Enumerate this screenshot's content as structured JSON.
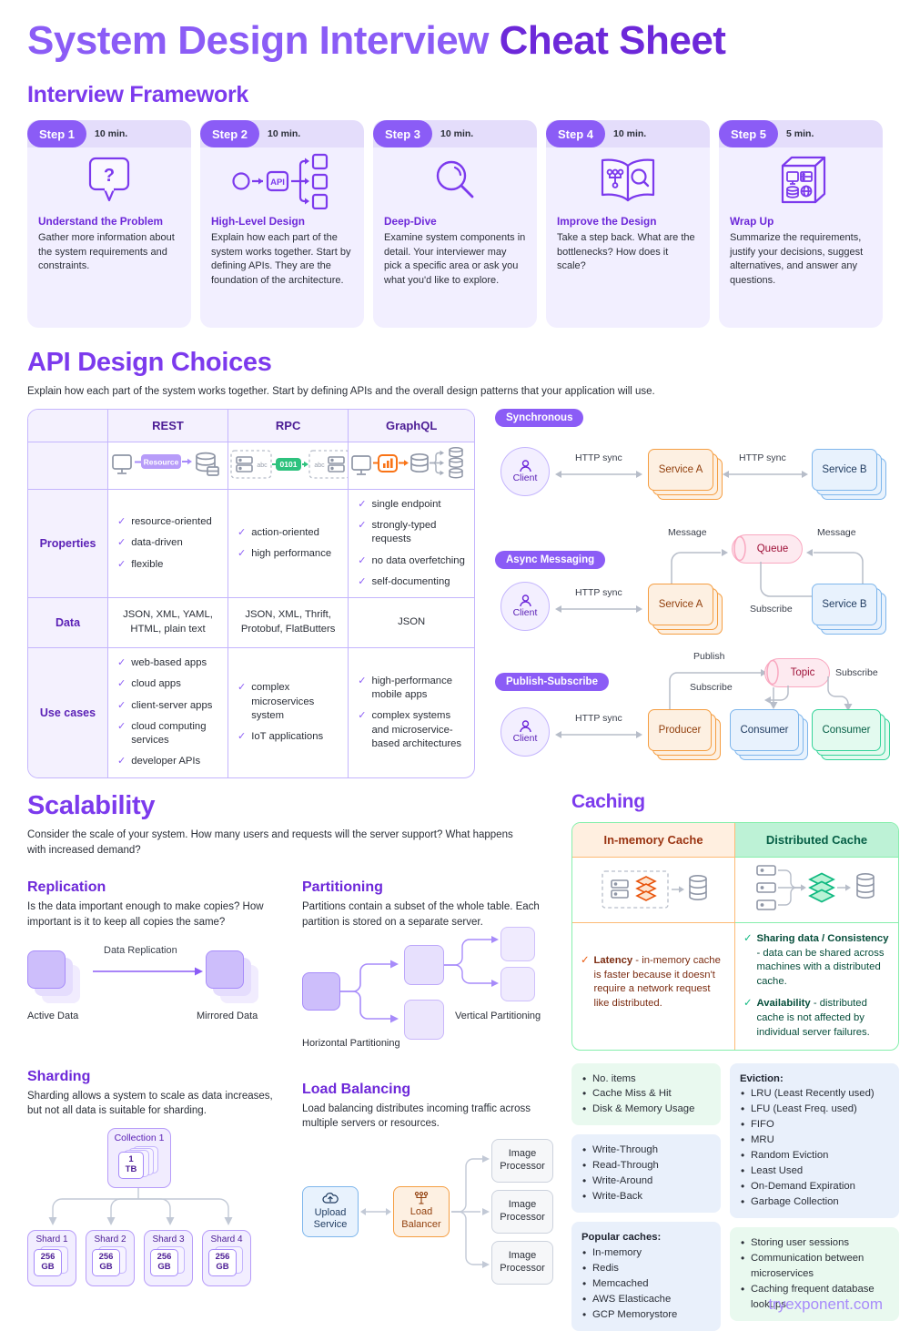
{
  "title": {
    "light": "System Design Interview ",
    "dark": "Cheat Sheet"
  },
  "brand": "tryexponent.com",
  "framework": {
    "heading": "Interview Framework",
    "steps": [
      {
        "step": "Step 1",
        "time": "10 min.",
        "name": "Understand the Problem",
        "desc": "Gather more information about the system requirements and constraints.",
        "icon": "question-bubble-icon"
      },
      {
        "step": "Step 2",
        "time": "10 min.",
        "name": "High-Level Design",
        "desc": "Explain how each part of the system works together. Start by defining APIs. They are the foundation of the architecture.",
        "icon": "api-flow-icon"
      },
      {
        "step": "Step 3",
        "time": "10 min.",
        "name": "Deep-Dive",
        "desc": "Examine system components in detail. Your interviewer may pick a specific area or ask you what you'd like to explore.",
        "icon": "magnifier-icon"
      },
      {
        "step": "Step 4",
        "time": "10 min.",
        "name": "Improve the Design",
        "desc": "Take a step back. What are the bottlenecks? How does it scale?",
        "icon": "open-book-icon"
      },
      {
        "step": "Step 5",
        "time": "5 min.",
        "name": "Wrap Up",
        "desc": "Summarize the requirements, justify your decisions, suggest alternatives, and answer any questions.",
        "icon": "package-box-icon"
      }
    ]
  },
  "api": {
    "heading": "API Design Choices",
    "intro": "Explain how each part of the system works together. Start by defining APIs and the overall design patterns that your application will use.",
    "columns": [
      "REST",
      "RPC",
      "GraphQL"
    ],
    "rows": {
      "properties_label": "Properties",
      "data_label": "Data",
      "usecases_label": "Use cases",
      "properties": [
        [
          "resource-oriented",
          "data-driven",
          "flexible"
        ],
        [
          "action-oriented",
          "high performance"
        ],
        [
          "single endpoint",
          "strongly-typed requests",
          "no data overfetching",
          "self-documenting"
        ]
      ],
      "data": [
        "JSON, XML, YAML, HTML, plain text",
        "JSON, XML, Thrift, Protobuf, FlatButters",
        "JSON"
      ],
      "usecases": [
        [
          "web-based apps",
          "cloud apps",
          "client-server apps",
          "cloud computing services",
          "developer APIs"
        ],
        [
          "complex microservices system",
          "IoT applications"
        ],
        [
          "high-performance mobile apps",
          "complex systems and microservice-based architectures"
        ]
      ]
    },
    "rest_badge": "Resource",
    "rpc_badge": "0101",
    "rpc_abc": "abc"
  },
  "comms": {
    "sync": {
      "tag": "Synchronous",
      "client": "Client",
      "service_a": "Service A",
      "service_b": "Service B",
      "edge1": "HTTP sync",
      "edge2": "HTTP sync"
    },
    "async": {
      "tag": "Async Messaging",
      "client": "Client",
      "service_a": "Service A",
      "service_b": "Service B",
      "queue": "Queue",
      "edge_http": "HTTP sync",
      "edge_msg1": "Message",
      "edge_msg2": "Message",
      "edge_sub": "Subscribe"
    },
    "pubsub": {
      "tag": "Publish-Subscribe",
      "client": "Client",
      "producer": "Producer",
      "consumer1": "Consumer",
      "consumer2": "Consumer",
      "topic": "Topic",
      "edge_http": "HTTP sync",
      "edge_publish": "Publish",
      "edge_sub1": "Subscribe",
      "edge_sub2": "Subscribe"
    }
  },
  "scalability": {
    "heading": "Scalability",
    "intro": "Consider the scale of your system. How many users and requests will the server support? What happens with increased demand?",
    "replication": {
      "title": "Replication",
      "desc": "Is the data important enough to make copies? How important is it to keep all copies the same?",
      "arrow_label": "Data Replication",
      "left_label": "Active Data",
      "right_label": "Mirrored Data"
    },
    "partitioning": {
      "title": "Partitioning",
      "desc": "Partitions contain a subset of the whole table. Each partition is stored on a separate server.",
      "horizontal_label": "Horizontal Partitioning",
      "vertical_label": "Vertical Partitioning"
    },
    "sharding": {
      "title": "Sharding",
      "desc": "Sharding allows a system to scale as data increases, but not all data is suitable for sharding.",
      "collection": "Collection 1",
      "collection_size_1": "1",
      "collection_size_2": "TB",
      "shards": [
        {
          "name": "Shard 1",
          "size1": "256",
          "size2": "GB"
        },
        {
          "name": "Shard 2",
          "size1": "256",
          "size2": "GB"
        },
        {
          "name": "Shard 3",
          "size1": "256",
          "size2": "GB"
        },
        {
          "name": "Shard 4",
          "size1": "256",
          "size2": "GB"
        }
      ]
    },
    "loadbalancing": {
      "title": "Load Balancing",
      "desc": "Load balancing distributes incoming traffic across multiple servers or resources.",
      "upload": "Upload\nService",
      "upload_l1": "Upload",
      "upload_l2": "Service",
      "lb_l1": "Load",
      "lb_l2": "Balancer",
      "proc_l1": "Image",
      "proc_l2": "Processor"
    }
  },
  "caching": {
    "heading": "Caching",
    "col_inmemory": "In-memory Cache",
    "col_distributed": "Distributed Cache",
    "inmemory_note_bold": "Latency",
    "inmemory_note_rest": " - in-memory cache is faster because it doesn't require a network request like distributed.",
    "dist_notes": [
      {
        "bold": "Sharing data / Consistency",
        "rest": " - data can be shared across machines with a distributed cache."
      },
      {
        "bold": "Availability",
        "rest": " - distributed cache is not affected by individual server failures."
      }
    ],
    "metrics": [
      "No. items",
      "Cache Miss & Hit",
      "Disk & Memory Usage"
    ],
    "strategies": [
      "Write-Through",
      "Read-Through",
      "Write-Around",
      "Write-Back"
    ],
    "popular_title": "Popular caches:",
    "popular": [
      "In-memory",
      "Redis",
      "Memcached",
      "AWS Elasticache",
      "GCP Memorystore"
    ],
    "eviction_title": "Eviction:",
    "eviction": [
      "LRU (Least Recently used)",
      "LFU (Least Freq. used)",
      "FIFO",
      "MRU",
      "Random Eviction",
      "Least Used",
      "On-Demand Expiration",
      "Garbage Collection"
    ],
    "usecases": [
      "Storing user sessions",
      "Communication between microservices",
      "Caching frequent database lookups"
    ]
  },
  "colors": {
    "purple": "#8b5cf6",
    "deep_purple": "#6d28d9",
    "orange": "#f59e42",
    "blue": "#7eb6ec",
    "green": "#34d399",
    "pink": "#f9a8c0"
  }
}
